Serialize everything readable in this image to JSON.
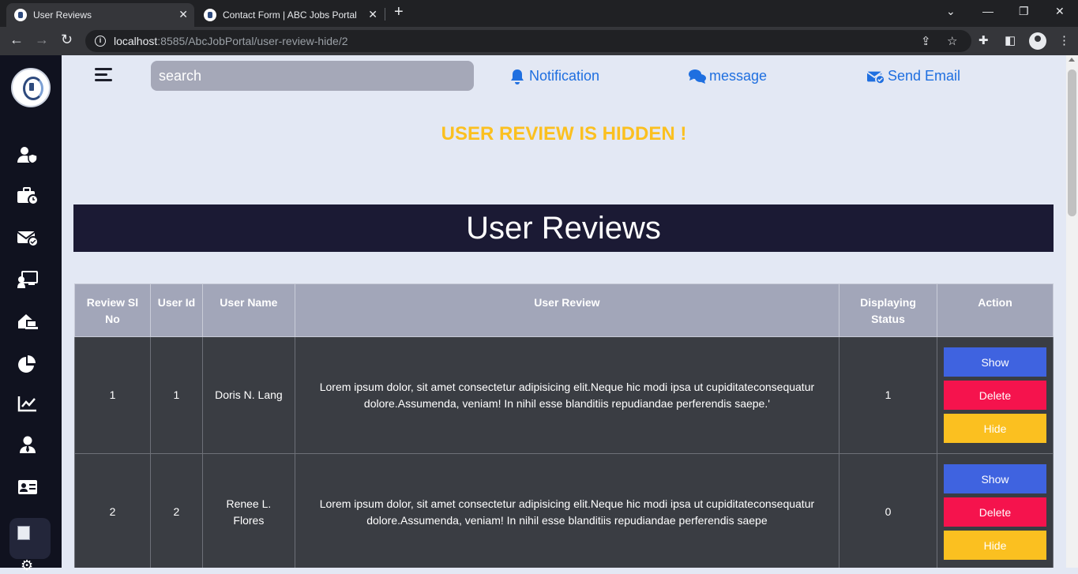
{
  "browser": {
    "tabs": [
      {
        "title": "User Reviews",
        "active": true
      },
      {
        "title": "Contact Form | ABC Jobs Portal",
        "active": false
      }
    ],
    "url": {
      "host": "localhost",
      "rest": ":8585/AbcJobPortal/user-review-hide/2"
    }
  },
  "topbar": {
    "search_placeholder": "search",
    "notification_label": "Notification",
    "message_label": "message",
    "send_email_label": "Send Email"
  },
  "alert": "USER REVIEW IS HIDDEN !",
  "page_title": "User Reviews",
  "table": {
    "headers": [
      "Review Sl No",
      "User Id",
      "User Name",
      "User Review",
      "Displaying Status",
      "Action"
    ],
    "rows": [
      {
        "sl": "1",
        "user_id": "1",
        "name": "Doris N. Lang",
        "review": "Lorem ipsum dolor, sit amet consectetur adipisicing elit.Neque hic modi ipsa ut cupiditateconsequatur dolore.Assumenda, veniam! In nihil esse blanditiis repudiandae perferendis saepe.'",
        "status": "1"
      },
      {
        "sl": "2",
        "user_id": "2",
        "name": "Renee L. Flores",
        "review": "Lorem ipsum dolor, sit amet consectetur adipisicing elit.Neque hic modi ipsa ut cupiditateconsequatur dolore.Assumenda, veniam! In nihil esse blanditiis repudiandae perferendis saepe",
        "status": "0"
      }
    ],
    "actions": {
      "show": "Show",
      "delete": "Delete",
      "hide": "Hide"
    }
  },
  "sidebar_icons": [
    "user-shield-icon",
    "briefcase-icon",
    "envelope-check-icon",
    "chalkboard-user-icon",
    "house-laptop-icon",
    "pie-chart-icon",
    "line-chart-icon",
    "user-tie-icon",
    "id-card-icon",
    "gear-icon"
  ],
  "colors": {
    "accent": "#1f6fe0",
    "alert": "#fbc020",
    "show": "#3f63e0",
    "delete": "#f5134d",
    "hide": "#fbc020",
    "banner": "#1b1a34"
  }
}
